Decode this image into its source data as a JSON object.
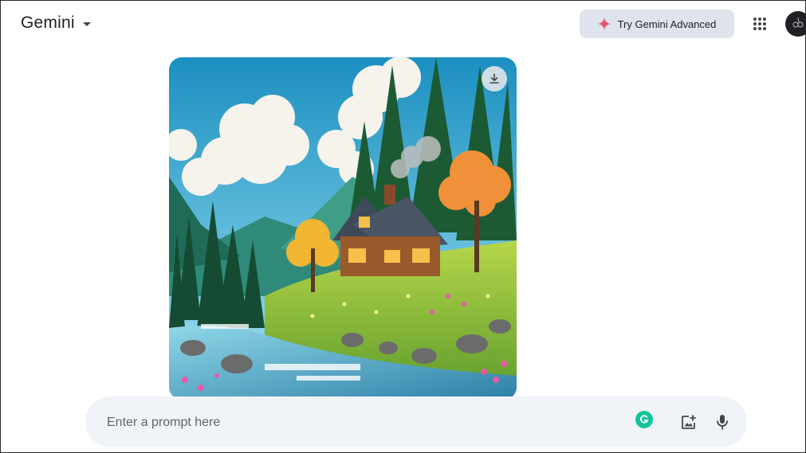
{
  "app": {
    "title": "Gemini"
  },
  "header": {
    "try_advanced_label": "Try Gemini Advanced"
  },
  "icons": {
    "brand_caret": "caret-down-icon",
    "sparkle": "sparkle-icon",
    "apps": "apps-grid-icon",
    "download": "download-icon",
    "grammarly": "grammarly-icon",
    "add_image": "add-image-icon",
    "mic": "microphone-icon"
  },
  "image": {
    "description": "generated-image"
  },
  "prompt": {
    "placeholder": "Enter a prompt here",
    "value": ""
  },
  "colors": {
    "try_button_bg": "#dfe3eb",
    "prompt_bg": "#f0f4f9",
    "sparkle": "#e8516d",
    "grammarly": "#15c39a"
  }
}
